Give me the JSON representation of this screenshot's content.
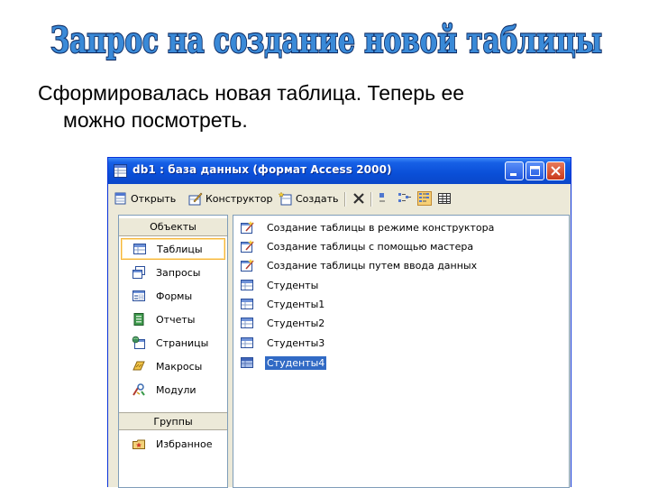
{
  "slide": {
    "title": "Запрос на создание новой таблицы",
    "text_line1": "Сформировалась новая таблица. Теперь ее",
    "text_line2": "можно посмотреть."
  },
  "window": {
    "title": "db1 : база данных (формат Access 2000)",
    "titlebar_color": "#0a4fd8",
    "controls": [
      "minimize-icon",
      "maximize-icon",
      "close-icon"
    ]
  },
  "toolbar": {
    "open_label": "Открыть",
    "design_label": "Конструктор",
    "create_label": "Создать",
    "icons": [
      "delete-icon",
      "large-icons-icon",
      "small-icons-icon",
      "list-view-icon",
      "details-view-icon"
    ]
  },
  "objects": {
    "header": "Объекты",
    "items": [
      {
        "label": "Таблицы",
        "icon": "table-icon",
        "selected": true
      },
      {
        "label": "Запросы",
        "icon": "query-icon"
      },
      {
        "label": "Формы",
        "icon": "form-icon"
      },
      {
        "label": "Отчеты",
        "icon": "report-icon"
      },
      {
        "label": "Страницы",
        "icon": "page-icon"
      },
      {
        "label": "Макросы",
        "icon": "macro-icon"
      },
      {
        "label": "Модули",
        "icon": "module-icon"
      }
    ],
    "groups_header": "Группы",
    "groups": [
      {
        "label": "Избранное",
        "icon": "favorites-icon"
      }
    ]
  },
  "tables_list": [
    {
      "label": "Создание таблицы в режиме конструктора",
      "icon": "wizard-icon"
    },
    {
      "label": "Создание таблицы с помощью мастера",
      "icon": "wizard-icon"
    },
    {
      "label": "Создание таблицы путем ввода данных",
      "icon": "wizard-icon"
    },
    {
      "label": "Студенты",
      "icon": "table-icon"
    },
    {
      "label": "Студенты1",
      "icon": "table-icon"
    },
    {
      "label": "Студенты2",
      "icon": "table-icon"
    },
    {
      "label": "Студенты3",
      "icon": "table-icon"
    },
    {
      "label": "Студенты4",
      "icon": "table-icon",
      "selected": true
    }
  ],
  "colors": {
    "selection": "#316ac5",
    "title_fill": "#3a8ad8",
    "title_outline": "#0d2b63"
  }
}
